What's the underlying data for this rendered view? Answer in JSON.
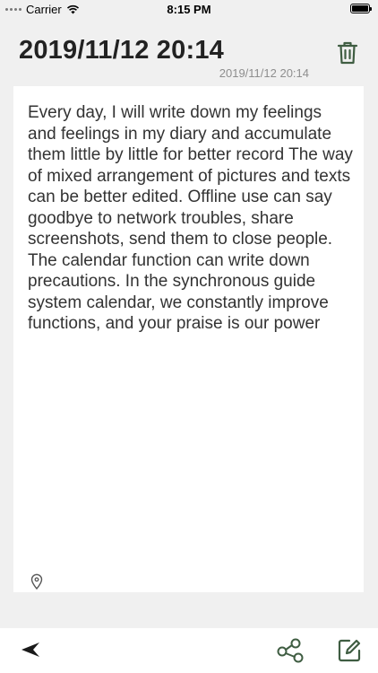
{
  "status_bar": {
    "carrier": "Carrier",
    "time": "8:15 PM"
  },
  "header": {
    "title": "2019/11/12 20:14",
    "subtitle": "2019/11/12 20:14"
  },
  "note": {
    "body": "Every day, I will write down my feelings and feelings in my diary and accumulate them little by little for better record The way of mixed arrangement of pictures and texts can be better edited. Offline use can say goodbye to network troubles, share screenshots, send them to close people. The calendar function can write down precautions. In the synchronous guide system calendar, we constantly improve functions, and your praise is our power"
  },
  "icons": {
    "trash": "trash-icon",
    "location": "location-pin-icon",
    "back": "back-arrow-icon",
    "share": "share-icon",
    "edit": "edit-icon",
    "wifi": "wifi-icon",
    "battery": "battery-icon"
  },
  "colors": {
    "accent": "#3f5d42",
    "background": "#f0f0f0",
    "card": "#ffffff"
  }
}
